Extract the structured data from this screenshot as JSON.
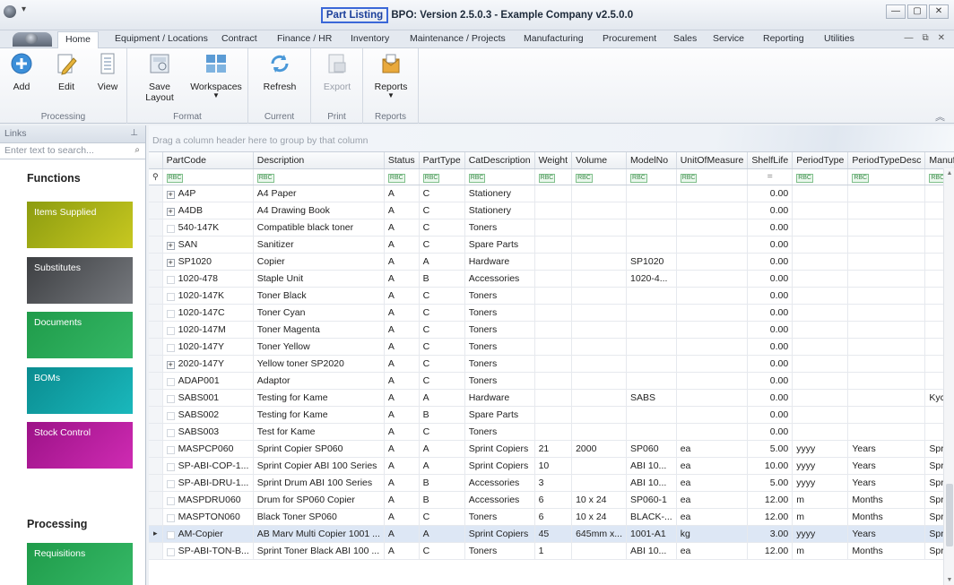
{
  "window": {
    "title_highlight": "Part Listing",
    "title_rest": "BPO: Version 2.5.0.3 - Example Company v2.5.0.0",
    "controls": [
      "—",
      "▢",
      "✕"
    ]
  },
  "tabs": [
    "Home",
    "Equipment / Locations",
    "Contract",
    "Finance / HR",
    "Inventory",
    "Maintenance / Projects",
    "Manufacturing",
    "Procurement",
    "Sales",
    "Service",
    "Reporting",
    "Utilities"
  ],
  "ribbon": {
    "groups": [
      {
        "label": "Processing",
        "buttons": [
          "Add",
          "Edit",
          "View"
        ]
      },
      {
        "label": "Format",
        "buttons": [
          "Save Layout",
          "Workspaces"
        ]
      },
      {
        "label": "Current",
        "buttons": [
          "Refresh"
        ]
      },
      {
        "label": "Print",
        "buttons": [
          "Export"
        ]
      },
      {
        "label": "Reports",
        "buttons": [
          "Reports"
        ]
      }
    ]
  },
  "links": {
    "header": "Links",
    "search_placeholder": "Enter text to search...",
    "functions_title": "Functions",
    "processing_title": "Processing",
    "tiles": [
      "Items Supplied",
      "Substitutes",
      "Documents",
      "BOMs",
      "Stock Control",
      "Requisitions"
    ]
  },
  "grid": {
    "group_hint": "Drag a column header here to group by that column",
    "columns": [
      "PartCode",
      "Description",
      "Status",
      "PartType",
      "CatDescription",
      "Weight",
      "Volume",
      "ModelNo",
      "UnitOfMeasure",
      "ShelfLife",
      "PeriodType",
      "PeriodTypeDesc",
      "Manufa"
    ],
    "rows": [
      [
        "A4P",
        "A4 Paper",
        "A",
        "C",
        "Stationery",
        "",
        "",
        "",
        "",
        "0.00",
        "",
        "",
        ""
      ],
      [
        "A4DB",
        "A4 Drawing Book",
        "A",
        "C",
        "Stationery",
        "",
        "",
        "",
        "",
        "0.00",
        "",
        "",
        ""
      ],
      [
        "540-147K",
        "Compatible black toner",
        "A",
        "C",
        "Toners",
        "",
        "",
        "",
        "",
        "0.00",
        "",
        "",
        ""
      ],
      [
        "SAN",
        "Sanitizer",
        "A",
        "C",
        "Spare Parts",
        "",
        "",
        "",
        "",
        "0.00",
        "",
        "",
        ""
      ],
      [
        "SP1020",
        "Copier",
        "A",
        "A",
        "Hardware",
        "",
        "",
        "SP1020",
        "",
        "0.00",
        "",
        "",
        ""
      ],
      [
        "1020-478",
        "Staple Unit",
        "A",
        "B",
        "Accessories",
        "",
        "",
        "1020-4...",
        "",
        "0.00",
        "",
        "",
        ""
      ],
      [
        "1020-147K",
        "Toner Black",
        "A",
        "C",
        "Toners",
        "",
        "",
        "",
        "",
        "0.00",
        "",
        "",
        ""
      ],
      [
        "1020-147C",
        "Toner Cyan",
        "A",
        "C",
        "Toners",
        "",
        "",
        "",
        "",
        "0.00",
        "",
        "",
        ""
      ],
      [
        "1020-147M",
        "Toner Magenta",
        "A",
        "C",
        "Toners",
        "",
        "",
        "",
        "",
        "0.00",
        "",
        "",
        ""
      ],
      [
        "1020-147Y",
        "Toner Yellow",
        "A",
        "C",
        "Toners",
        "",
        "",
        "",
        "",
        "0.00",
        "",
        "",
        ""
      ],
      [
        "2020-147Y",
        "Yellow toner SP2020",
        "A",
        "C",
        "Toners",
        "",
        "",
        "",
        "",
        "0.00",
        "",
        "",
        ""
      ],
      [
        "ADAP001",
        "Adaptor",
        "A",
        "C",
        "Toners",
        "",
        "",
        "",
        "",
        "0.00",
        "",
        "",
        ""
      ],
      [
        "SABS001",
        "Testing for Kame",
        "A",
        "A",
        "Hardware",
        "",
        "",
        "SABS",
        "",
        "0.00",
        "",
        "",
        "Kyc"
      ],
      [
        "SABS002",
        "Testing for Kame",
        "A",
        "B",
        "Spare Parts",
        "",
        "",
        "",
        "",
        "0.00",
        "",
        "",
        ""
      ],
      [
        "SABS003",
        "Test for Kame",
        "A",
        "C",
        "Toners",
        "",
        "",
        "",
        "",
        "0.00",
        "",
        "",
        ""
      ],
      [
        "MASPCP060",
        "Sprint Copier SP060",
        "A",
        "A",
        "Sprint Copiers",
        "21",
        "2000",
        "SP060",
        "ea",
        "5.00",
        "yyyy",
        "Years",
        "Spr"
      ],
      [
        "SP-ABI-COP-1...",
        "Sprint Copier ABI 100 Series",
        "A",
        "A",
        "Sprint Copiers",
        "10",
        "",
        "ABI 10...",
        "ea",
        "10.00",
        "yyyy",
        "Years",
        "Spr"
      ],
      [
        "SP-ABI-DRU-1...",
        "Sprint Drum ABI 100 Series",
        "A",
        "B",
        "Accessories",
        "3",
        "",
        "ABI 10...",
        "ea",
        "5.00",
        "yyyy",
        "Years",
        "Spr"
      ],
      [
        "MASPDRU060",
        "Drum for SP060 Copier",
        "A",
        "B",
        "Accessories",
        "6",
        "10 x 24",
        "SP060-1",
        "ea",
        "12.00",
        "m",
        "Months",
        "Spr"
      ],
      [
        "MASPTON060",
        "Black Toner SP060",
        "A",
        "C",
        "Toners",
        "6",
        "10 x 24",
        "BLACK-...",
        "ea",
        "12.00",
        "m",
        "Months",
        "Spr"
      ],
      [
        "AM-Copier",
        "AB Marv Multi Copier 1001 ...",
        "A",
        "A",
        "Sprint Copiers",
        "45",
        "645mm x...",
        "1001-A1",
        "kg",
        "3.00",
        "yyyy",
        "Years",
        "Spr"
      ],
      [
        "SP-ABI-TON-B...",
        "Sprint Toner Black ABI 100 ...",
        "A",
        "C",
        "Toners",
        "1",
        "",
        "ABI 10...",
        "ea",
        "12.00",
        "m",
        "Months",
        "Spr"
      ]
    ],
    "expandable": [
      true,
      true,
      false,
      true,
      true,
      false,
      false,
      false,
      false,
      false,
      true,
      false,
      false,
      false,
      false,
      false,
      false,
      false,
      false,
      false,
      false,
      false
    ],
    "selected_row": 20,
    "filter_symbol": "=",
    "filter_icon_text": "RBC"
  },
  "colors": {
    "tile_yellow": "#aab11a",
    "tile_gray": "#5a5d62",
    "tile_green": "#2aa855",
    "tile_teal": "#0f9ea2",
    "tile_magenta": "#b41a9c"
  }
}
